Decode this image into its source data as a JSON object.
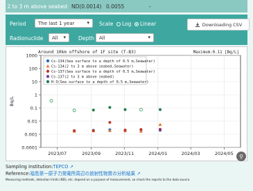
{
  "top_row": {
    "label": "2 to 3 m above seabed",
    "value1": "ND(0.0014)",
    "value2": "0.0055",
    "value3": "-"
  },
  "controls": {
    "period_label": "Period",
    "period_value": "The last 1 year",
    "scale_label": "Scale",
    "scale_options": [
      "Log",
      "Linear"
    ],
    "scale_selected": "Linear",
    "download_label": "Downloading CSV",
    "radionuclide_label": "Radionuclide",
    "radionuclide_value": "All",
    "depth_label": "Depth",
    "depth_value": "All"
  },
  "chart_data": {
    "type": "scatter",
    "title": "Around 10km offshore of 1F site (T-B3)",
    "annotation": "Maximum:0.11 [Bq/L]",
    "ylabel": "Bq/L",
    "yscale": "log",
    "ylim": [
      0.0001,
      1000
    ],
    "yticks": [
      "1000",
      "100",
      "10",
      "1",
      "0.1",
      "0.01",
      "0.001",
      "0.0001"
    ],
    "xticks": [
      "2023/07",
      "2023/09",
      "2023/11",
      "2024/01",
      "2024/03",
      "2024/05"
    ],
    "xlim": [
      "2023-06",
      "2024-05-31"
    ],
    "series": [
      {
        "name": "Cs-134(Sea surface to a depth of 0.5 m,Seawater)",
        "color": "#1f6fb4",
        "marker": "circle",
        "points": [
          [
            "2023-08-01",
            0.0018
          ],
          [
            "2023-09-05",
            0.002
          ],
          [
            "2023-10-05",
            0.0022
          ],
          [
            "2023-11-02",
            0.002
          ],
          [
            "2023-12-01",
            0.0021
          ],
          [
            "2024-01-05",
            0.002
          ]
        ]
      },
      {
        "name": "Cs-134(2 to 3 m above seabed,Seawater)",
        "color": "#e07b39",
        "marker": "triangle",
        "points": [
          [
            "2023-08-01",
            0.0017
          ],
          [
            "2023-09-05",
            0.0018
          ],
          [
            "2023-10-05",
            0.0019
          ],
          [
            "2023-11-02",
            0.0018
          ],
          [
            "2023-12-01",
            0.0017
          ],
          [
            "2024-01-05",
            0.0055
          ]
        ]
      },
      {
        "name": "Cs-137(Sea surface to a depth of 0.5 m,Seawater)",
        "color": "#c0392b",
        "marker": "circle",
        "points": [
          [
            "2023-08-01",
            0.0019
          ],
          [
            "2023-09-05",
            0.0019
          ],
          [
            "2023-10-05",
            0.008
          ],
          [
            "2023-11-02",
            0.0021
          ],
          [
            "2023-12-01",
            0.0023
          ],
          [
            "2024-01-05",
            0.0024
          ]
        ]
      },
      {
        "name": "Cs-137(2 to 3 m above seabed)",
        "color": "#7d3c98",
        "marker": "circle",
        "points": [
          [
            "2024-01-05",
            0.0021
          ]
        ]
      },
      {
        "name": "H-3(Sea surface to a depth of 0.5 m,Seawater)",
        "color": "#1e7d4b",
        "marker": "circle",
        "points": [
          [
            "2023-06-20",
            0.35
          ],
          [
            "2023-08-01",
            0.065
          ],
          [
            "2023-09-05",
            0.07
          ],
          [
            "2023-10-05",
            0.11
          ],
          [
            "2023-11-02",
            0.075
          ],
          [
            "2023-12-01",
            0.075
          ],
          [
            "2024-01-05",
            0.075
          ]
        ]
      }
    ],
    "nd_series": [
      {
        "name": "H-3 ND",
        "color": "#2e9e5a",
        "marker": "hollow-circle",
        "points": [
          [
            "2023-06-20",
            0.35
          ],
          [
            "2023-08-01",
            0.065
          ],
          [
            "2023-12-01",
            0.075
          ]
        ]
      }
    ]
  },
  "footer": {
    "sampling_label": "Sampling institution:",
    "sampling_value": "TEPCO",
    "reference_label": "Reference:",
    "reference_value": "福島第一原子力発電所周辺の放射性物質の分析結果",
    "note": "Measuring methods, detection limits (ND), etc. depend on a purpose of measurement, so check the reports to the data source."
  }
}
